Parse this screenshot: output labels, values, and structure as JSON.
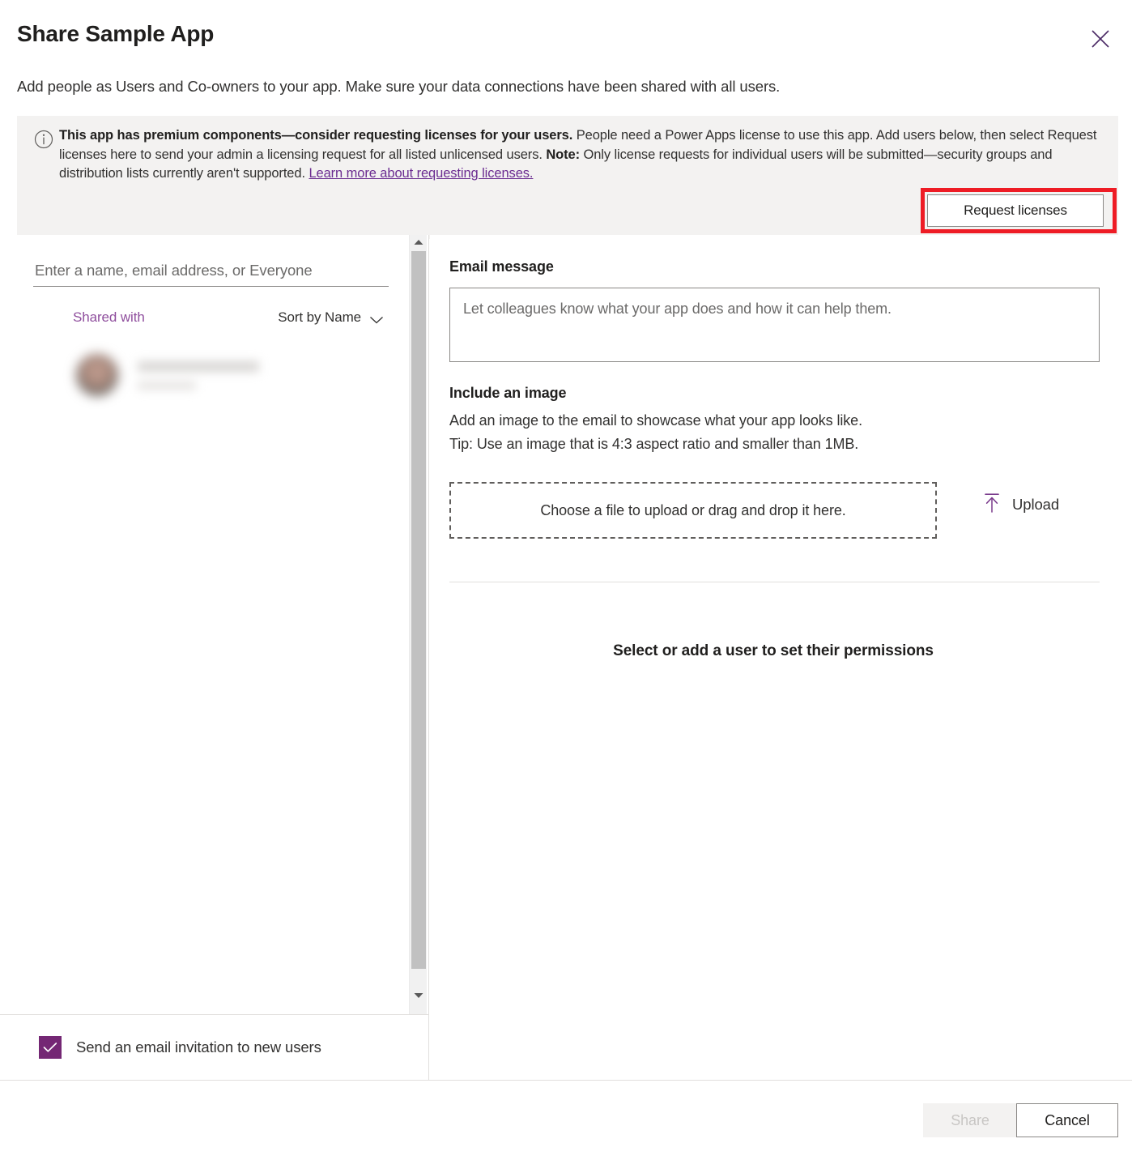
{
  "dialog": {
    "title": "Share Sample App",
    "subtitle": "Add people as Users and Co-owners to your app. Make sure your data connections have been shared with all users.",
    "close_icon": "close-icon"
  },
  "banner": {
    "icon": "info-icon",
    "bold_lead": "This app has premium components—consider requesting licenses for your users.",
    "body_1": " People need a Power Apps license to use this app. Add users below, then select Request licenses here to send your admin a licensing request for all listed unlicensed users. ",
    "note_label": "Note:",
    "body_2": " Only license requests for individual users will be submitted—security groups and distribution lists currently aren't supported. ",
    "link_text": "Learn more about requesting licenses.",
    "request_button": "Request licenses",
    "highlight_color": "#ee1c25",
    "background_color": "#f3f2f1",
    "link_color": "#6b2c91"
  },
  "left_pane": {
    "people_input_placeholder": "Enter a name, email address, or Everyone",
    "people_input_value": "",
    "shared_with_label": "Shared with",
    "sort_by_label": "Sort by Name",
    "sort_chevron_icon": "chevron-down-icon",
    "shared_with_color": "#8f4e9d",
    "users": [
      {
        "name": "",
        "subtitle": "",
        "redacted": true
      }
    ],
    "scrollbar": {
      "up_arrow_icon": "caret-up-icon",
      "down_arrow_icon": "caret-down-icon"
    },
    "email_invite_checkbox": {
      "label": "Send an email invitation to new users",
      "checked": true,
      "check_icon": "checkmark-icon",
      "color": "#742774"
    }
  },
  "right_pane": {
    "email_message_label": "Email message",
    "email_message_placeholder": "Let colleagues know what your app does and how it can help them.",
    "email_message_value": "",
    "include_image_label": "Include an image",
    "image_desc_line1": "Add an image to the email to showcase what your app looks like.",
    "image_desc_line2": "Tip: Use an image that is 4:3 aspect ratio and smaller than 1MB.",
    "dropzone_text": "Choose a file to upload or drag and drop it here.",
    "upload_label": "Upload",
    "upload_icon": "upload-icon",
    "permissions_message": "Select or add a user to set their permissions"
  },
  "footer": {
    "share_label": "Share",
    "share_disabled": true,
    "cancel_label": "Cancel"
  }
}
